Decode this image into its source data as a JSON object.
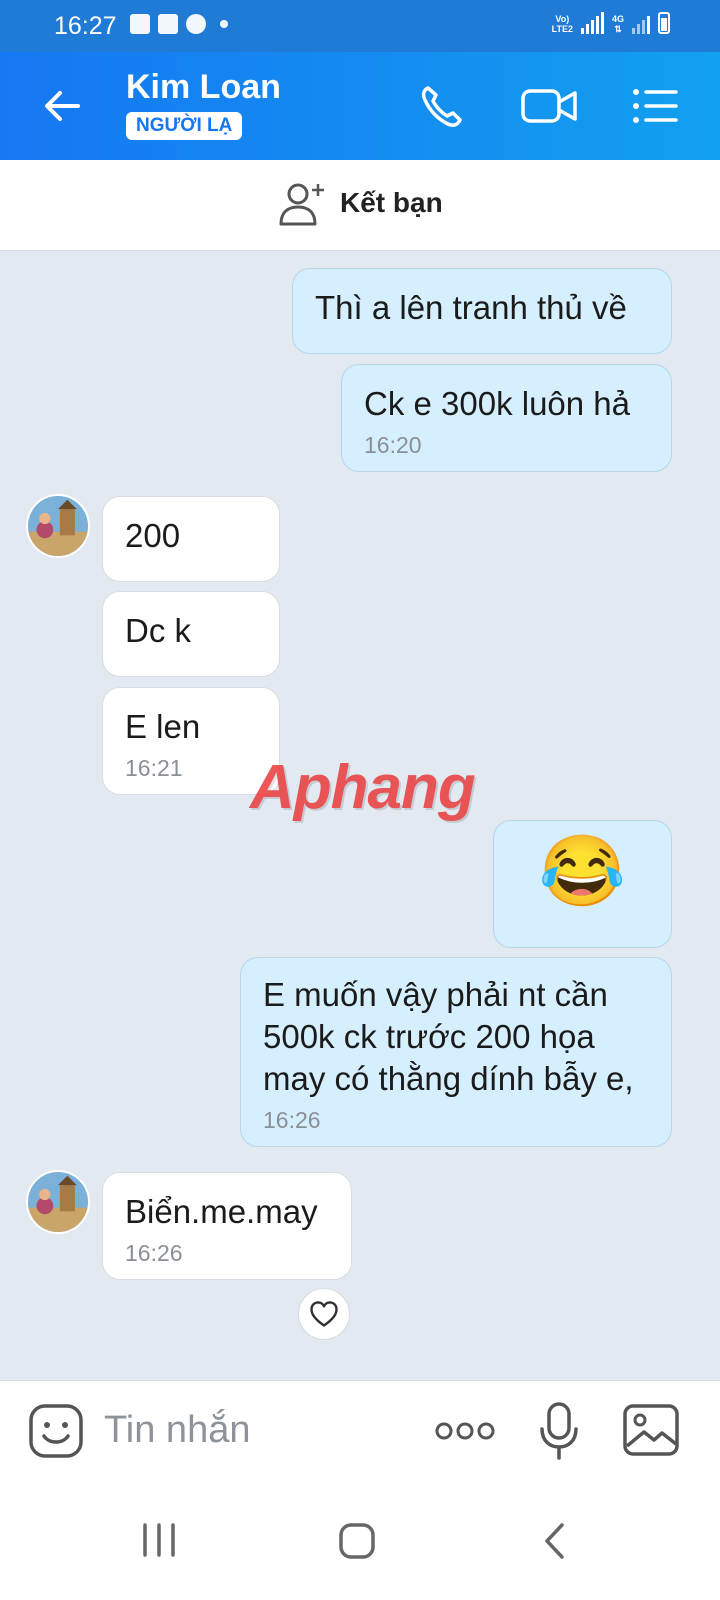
{
  "status_bar": {
    "time": "16:27",
    "icons": [
      "gallery-icon",
      "message-icon",
      "facebook-icon",
      "dot-icon",
      "volte-icon",
      "signal-icon",
      "4g-icon",
      "battery-icon"
    ],
    "network_label": "4G"
  },
  "header": {
    "contact_name": "Kim Loan",
    "contact_badge": "NGƯỜI LẠ",
    "icons": [
      "back-arrow-icon",
      "phone-icon",
      "video-call-icon",
      "menu-list-icon"
    ]
  },
  "friend_bar": {
    "label": "Kết bạn",
    "icon": "add-user-icon"
  },
  "messages": [
    {
      "side": "out",
      "text": "Thì a lên tranh thủ về",
      "time": ""
    },
    {
      "side": "out",
      "text": "Ck e 300k luôn hả",
      "time": "16:20"
    },
    {
      "side": "in",
      "text": "200",
      "time": ""
    },
    {
      "side": "in",
      "text": "Dc k",
      "time": ""
    },
    {
      "side": "in",
      "text": "E len",
      "time": "16:21"
    },
    {
      "side": "out",
      "text": "😂",
      "time": ""
    },
    {
      "side": "out",
      "text": "E muốn vậy phải nt cần 500k ck trước 200 họa may có thằng dính bẫy e,",
      "time": "16:26"
    },
    {
      "side": "in",
      "text": "Biển.me.may",
      "time": "16:26"
    }
  ],
  "watermark": "Aphang",
  "composer": {
    "placeholder": "Tin nhắn",
    "icons": [
      "emoji-icon",
      "more-options-icon",
      "microphone-icon",
      "image-icon"
    ]
  },
  "nav_bar": {
    "icons": [
      "recent-apps-icon",
      "home-icon",
      "back-icon"
    ]
  },
  "colors": {
    "header_start": "#1677f2",
    "header_end": "#12a0f0",
    "outgoing_bubble": "#d5efff",
    "incoming_bubble": "#ffffff",
    "chat_background": "#e2e9f1"
  }
}
